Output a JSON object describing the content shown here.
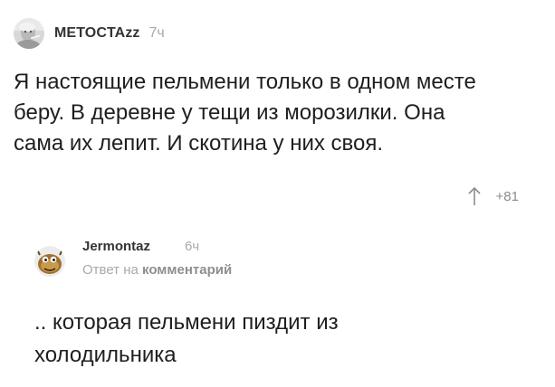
{
  "comment": {
    "author": "METOCTAzz",
    "time": "7ч",
    "text_lines": [
      "Я настоящие пельмени только в одном месте",
      "беру. В деревне у тещи из морозилки. Она",
      "сама их лепит. И скотина у них своя."
    ],
    "rating": "+81",
    "rating_icon": "arrow-up-icon"
  },
  "reply": {
    "author": "Jermontaz",
    "time": "6ч",
    "reply_prefix": "Ответ на",
    "reply_link": "комментарий",
    "text_lines": [
      ".. которая пельмени пиздит из",
      "холодильника"
    ]
  },
  "colors": {
    "text": "#1e1e1e",
    "muted": "#a9a9a9",
    "background": "#ffffff"
  }
}
